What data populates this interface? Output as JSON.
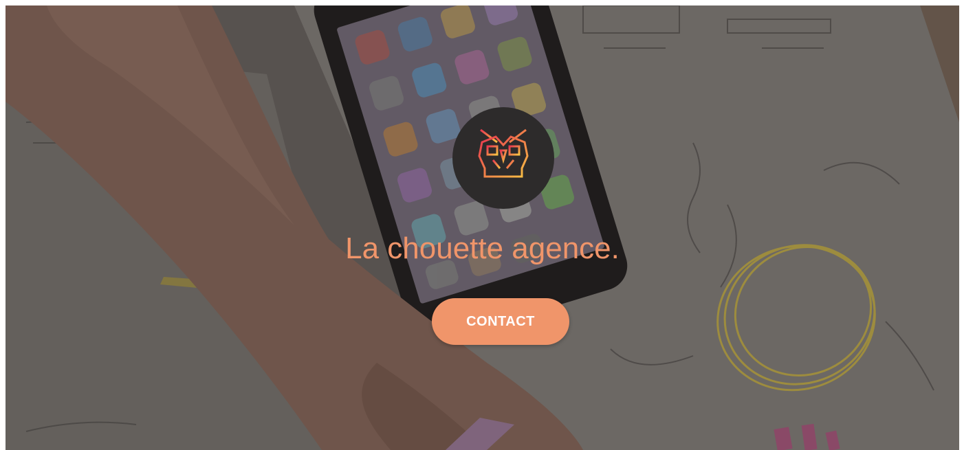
{
  "hero": {
    "tagline": "La chouette agence.",
    "contact_label": "CONTACT",
    "logo_icon": "owl-icon"
  },
  "colors": {
    "accent": "#f0956a",
    "logo_background": "#2d2b2b",
    "logo_gradient_start": "#e8374f",
    "logo_gradient_end": "#f7c244"
  }
}
